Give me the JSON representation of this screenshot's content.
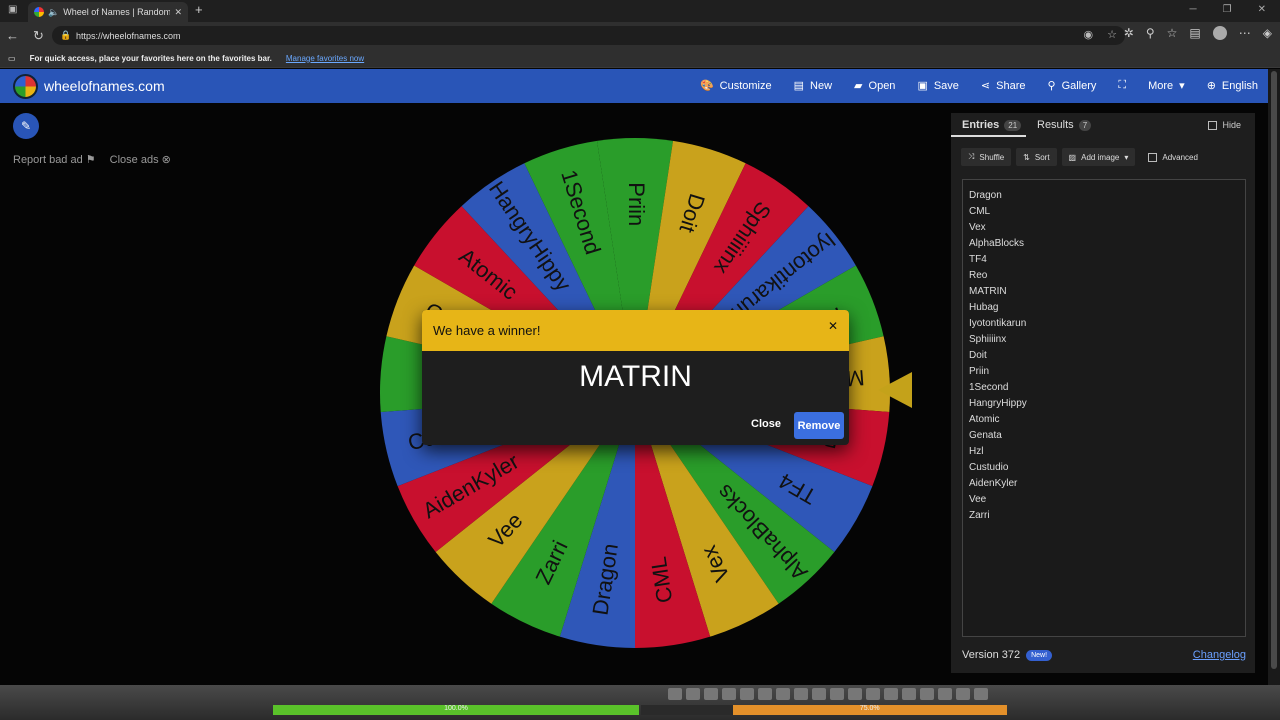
{
  "browser": {
    "tab_title": "Wheel of Names | Random",
    "url": "https://wheelofnames.com",
    "favbar_text": "For quick access, place your favorites here on the favorites bar.",
    "favbar_link": "Manage favorites now"
  },
  "header": {
    "brand": "wheelofnames.com",
    "menu": [
      {
        "label": "Customize",
        "icon": "palette-icon"
      },
      {
        "label": "New",
        "icon": "file-icon"
      },
      {
        "label": "Open",
        "icon": "folder-icon"
      },
      {
        "label": "Save",
        "icon": "save-icon"
      },
      {
        "label": "Share",
        "icon": "share-icon"
      },
      {
        "label": "Gallery",
        "icon": "search-icon"
      },
      {
        "label": "More",
        "icon": "chevron-down-icon"
      },
      {
        "label": "English",
        "icon": "globe-icon"
      }
    ]
  },
  "left": {
    "report_ad": "Report bad ad",
    "close_ads": "Close ads"
  },
  "wheel": {
    "colors": [
      "#c8102e",
      "#2a9d2a",
      "#c9a21c",
      "#2f57b8"
    ],
    "segments": [
      "Priin",
      "Doit",
      "Sphiiiinx",
      "Iyotontikarun",
      "Hubag",
      "MATRIN",
      "Reo",
      "TF4",
      "AlphaBlocks",
      "Vex",
      "CML",
      "Dragon",
      "Zarri",
      "Vee",
      "AidenKyler",
      "Custudio",
      "Hzl",
      "Genata",
      "Atomic",
      "HangryHippy",
      "1Second"
    ]
  },
  "dialog": {
    "title": "We have a winner!",
    "winner": "MATRIN",
    "close_label": "Close",
    "remove_label": "Remove"
  },
  "panel": {
    "tab_entries": "Entries",
    "entries_count": "21",
    "tab_results": "Results",
    "results_count": "7",
    "hide_label": "Hide",
    "shuffle_label": "Shuffle",
    "sort_label": "Sort",
    "add_image_label": "Add image",
    "advanced_label": "Advanced",
    "entries": [
      "Dragon",
      "CML",
      "Vex",
      "AlphaBlocks",
      "TF4",
      "Reo",
      "MATRIN",
      "Hubag",
      "Iyotontikarun",
      "Sphiiiinx",
      "Doit",
      "Priin",
      "1Second",
      "HangryHippy",
      "Atomic",
      "Genata",
      "Hzl",
      "Custudio",
      "AidenKyler",
      "Vee",
      "Zarri"
    ],
    "version": "Version 372",
    "new_badge": "New!",
    "changelog": "Changelog"
  },
  "gamebar": {
    "bar1_label": "100.0%",
    "bar2_label": "75.0%",
    "bar2_fill": 0.75
  }
}
